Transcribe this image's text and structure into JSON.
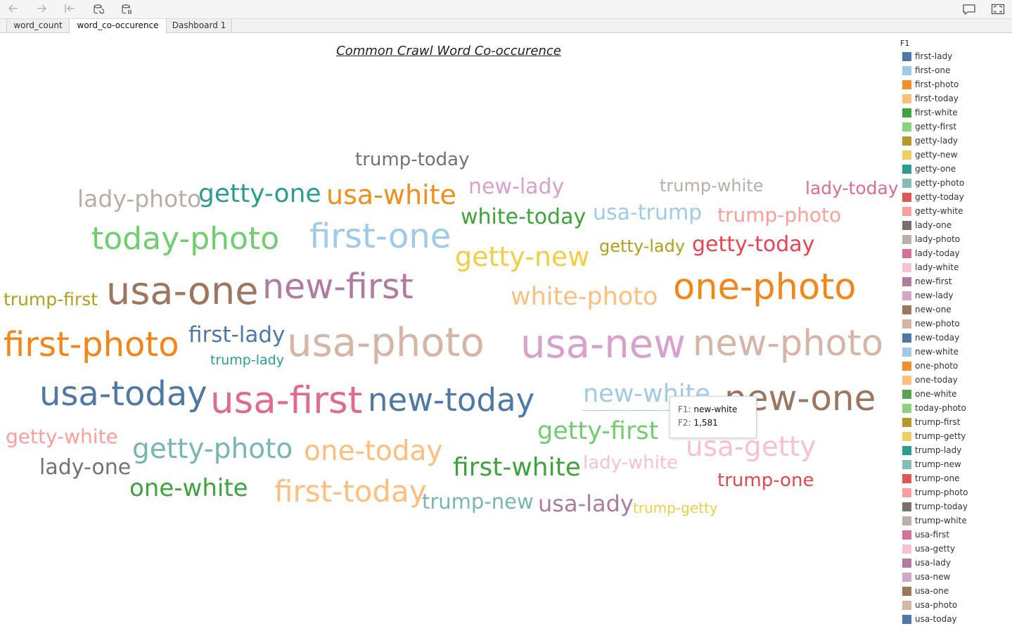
{
  "toolbar": {
    "buttons": [
      {
        "name": "back-icon",
        "glyph": "←"
      },
      {
        "name": "forward-icon",
        "glyph": "→"
      },
      {
        "name": "revert-icon",
        "glyph": "⇤"
      },
      {
        "name": "refresh-icon",
        "glyph": ""
      },
      {
        "name": "pause-updates-icon",
        "glyph": ""
      }
    ],
    "right_buttons": [
      {
        "name": "comment-icon"
      },
      {
        "name": "fullscreen-icon"
      }
    ]
  },
  "tabs": [
    {
      "label": "word_count",
      "active": false
    },
    {
      "label": "word_co-occurence",
      "active": true
    },
    {
      "label": "Dashboard 1",
      "active": false
    }
  ],
  "title": "Common Crawl Word Co-occurence",
  "words": [
    {
      "text": "trump-today",
      "color": "#7a7070"
    },
    {
      "text": "lady-photo",
      "color": "#b9ada6"
    },
    {
      "text": "getty-one",
      "color": "#2a9d8f"
    },
    {
      "text": "usa-white",
      "color": "#f28e1c"
    },
    {
      "text": "new-lady",
      "color": "#d9a0cc"
    },
    {
      "text": "trump-white",
      "color": "#b9ada6"
    },
    {
      "text": "lady-today",
      "color": "#e06b8e"
    },
    {
      "text": "white-today",
      "color": "#3ba53b"
    },
    {
      "text": "usa-trump",
      "color": "#9fcbe8"
    },
    {
      "text": "trump-photo",
      "color": "#ff9d9a"
    },
    {
      "text": "today-photo",
      "color": "#6fcf6f"
    },
    {
      "text": "first-one",
      "color": "#9fcbe8"
    },
    {
      "text": "getty-new",
      "color": "#f1ce46"
    },
    {
      "text": "getty-lady",
      "color": "#b59e1b"
    },
    {
      "text": "getty-today",
      "color": "#e8454f"
    },
    {
      "text": "trump-first",
      "color": "#b59e1b"
    },
    {
      "text": "usa-one",
      "color": "#9d7660"
    },
    {
      "text": "new-first",
      "color": "#b07aa1"
    },
    {
      "text": "white-photo",
      "color": "#ffbe7d"
    },
    {
      "text": "one-photo",
      "color": "#f58518"
    },
    {
      "text": "first-photo",
      "color": "#f58518"
    },
    {
      "text": "first-lady",
      "color": "#4e79a7"
    },
    {
      "text": "trump-lady",
      "color": "#2a9d8f"
    },
    {
      "text": "usa-photo",
      "color": "#d7b5a6"
    },
    {
      "text": "usa-new",
      "color": "#d9a0cc"
    },
    {
      "text": "new-photo",
      "color": "#d7b5a6"
    },
    {
      "text": "usa-today",
      "color": "#4e79a7"
    },
    {
      "text": "usa-first",
      "color": "#e06b8e"
    },
    {
      "text": "new-today",
      "color": "#4e79a7"
    },
    {
      "text": "new-white",
      "color": "#9fcbe8"
    },
    {
      "text": "new-one",
      "color": "#9d7660"
    },
    {
      "text": "getty-white",
      "color": "#ff9d9a"
    },
    {
      "text": "getty-photo",
      "color": "#76b7b2"
    },
    {
      "text": "one-today",
      "color": "#ffbe7d"
    },
    {
      "text": "getty-first",
      "color": "#6fcf6f"
    },
    {
      "text": "usa-getty",
      "color": "#fabfd2"
    },
    {
      "text": "lady-one",
      "color": "#7a7070"
    },
    {
      "text": "first-white",
      "color": "#3ba53b"
    },
    {
      "text": "lady-white",
      "color": "#fabfd2"
    },
    {
      "text": "one-white",
      "color": "#3ba53b"
    },
    {
      "text": "first-today",
      "color": "#ffbe7d"
    },
    {
      "text": "trump-new",
      "color": "#76b7b2"
    },
    {
      "text": "usa-lady",
      "color": "#b07aa1"
    },
    {
      "text": "trump-getty",
      "color": "#f1ce46"
    },
    {
      "text": "trump-one",
      "color": "#e8454f"
    }
  ],
  "tooltip": {
    "f1_key": "F1:",
    "f1_value": "new-white",
    "f2_key": "F2:",
    "f2_value": "1,581"
  },
  "legend": {
    "title": "F1",
    "items": [
      {
        "label": "first-lady",
        "color": "#4e79a7"
      },
      {
        "label": "first-one",
        "color": "#a0cbe8"
      },
      {
        "label": "first-photo",
        "color": "#f28e2b"
      },
      {
        "label": "first-today",
        "color": "#ffbe7d"
      },
      {
        "label": "first-white",
        "color": "#3ba53b"
      },
      {
        "label": "getty-first",
        "color": "#8cd17d"
      },
      {
        "label": "getty-lady",
        "color": "#b6992d"
      },
      {
        "label": "getty-new",
        "color": "#f1ce63"
      },
      {
        "label": "getty-one",
        "color": "#2a9d8f"
      },
      {
        "label": "getty-photo",
        "color": "#86bcb6"
      },
      {
        "label": "getty-today",
        "color": "#e15759"
      },
      {
        "label": "getty-white",
        "color": "#ff9d9a"
      },
      {
        "label": "lady-one",
        "color": "#79706e"
      },
      {
        "label": "lady-photo",
        "color": "#bab0ac"
      },
      {
        "label": "lady-today",
        "color": "#d37295"
      },
      {
        "label": "lady-white",
        "color": "#fabfd2"
      },
      {
        "label": "new-first",
        "color": "#b07aa1"
      },
      {
        "label": "new-lady",
        "color": "#d4a6c8"
      },
      {
        "label": "new-one",
        "color": "#9d7660"
      },
      {
        "label": "new-photo",
        "color": "#d7b5a6"
      },
      {
        "label": "new-today",
        "color": "#4e79a7"
      },
      {
        "label": "new-white",
        "color": "#a0cbe8"
      },
      {
        "label": "one-photo",
        "color": "#f28e2b"
      },
      {
        "label": "one-today",
        "color": "#ffbe7d"
      },
      {
        "label": "one-white",
        "color": "#59a14f"
      },
      {
        "label": "today-photo",
        "color": "#8cd17d"
      },
      {
        "label": "trump-first",
        "color": "#b6992d"
      },
      {
        "label": "trump-getty",
        "color": "#f1ce63"
      },
      {
        "label": "trump-lady",
        "color": "#2a9d8f"
      },
      {
        "label": "trump-new",
        "color": "#86bcb6"
      },
      {
        "label": "trump-one",
        "color": "#e15759"
      },
      {
        "label": "trump-photo",
        "color": "#ff9d9a"
      },
      {
        "label": "trump-today",
        "color": "#79706e"
      },
      {
        "label": "trump-white",
        "color": "#bab0ac"
      },
      {
        "label": "usa-first",
        "color": "#d37295"
      },
      {
        "label": "usa-getty",
        "color": "#fabfd2"
      },
      {
        "label": "usa-lady",
        "color": "#b07aa1"
      },
      {
        "label": "usa-new",
        "color": "#d4a6c8"
      },
      {
        "label": "usa-one",
        "color": "#9d7660"
      },
      {
        "label": "usa-photo",
        "color": "#d7b5a6"
      },
      {
        "label": "usa-today",
        "color": "#4e79a7"
      }
    ]
  }
}
